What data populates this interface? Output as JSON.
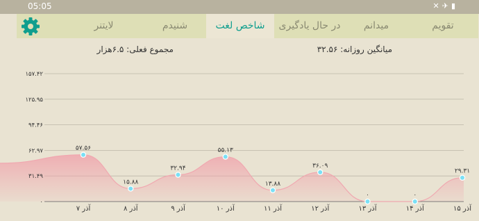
{
  "status_bar": {
    "time": "05:05",
    "icons": [
      "mute-icon",
      "airplane-icon",
      "battery-icon"
    ]
  },
  "tabs": [
    {
      "label": "تقویم",
      "active": false
    },
    {
      "label": "میدانم",
      "active": false
    },
    {
      "label": "در حال یادگیری",
      "active": false
    },
    {
      "label": "شاخص لغت",
      "active": true
    },
    {
      "label": "شنیدم",
      "active": false
    },
    {
      "label": "لایتنر",
      "active": false
    }
  ],
  "settings_icon": "gear-icon",
  "summary": {
    "daily_average": "میانگین روزانه: ۳۲.۵۶",
    "actual_total": "مجموع فعلی: ۶.۵هزار"
  },
  "colors": {
    "accent": "#0f9e8e",
    "tab_bar": "#dedfb6",
    "background": "#e9e3d2",
    "line": "#f0a8b0",
    "point": "#7ae0f5"
  },
  "chart_data": {
    "type": "area",
    "ylim": [
      0,
      157.42
    ],
    "y_ticks": [
      "157.42",
      "125.95",
      "94.46",
      "62.97",
      "31.49",
      "0"
    ],
    "y_tick_labels": [
      "۱۵۷.۴۲",
      "۱۲۵.۹۵",
      "۹۴.۴۶",
      "۶۲.۹۷",
      "۳۱.۴۹",
      "۰"
    ],
    "x_labels": [
      "۷ آذر",
      "۸ آذر",
      "۹ آذر",
      "۱۰ آذر",
      "۱۱ آذر",
      "۱۲ آذر",
      "۱۳ آذر",
      "۱۴ آذر",
      "۱۵ آذر"
    ],
    "values": [
      57.56,
      15.88,
      32.94,
      55.13,
      13.88,
      36.09,
      0,
      0,
      29.31
    ],
    "value_labels": [
      "۵۷.۵۶",
      "۱۵.۸۸",
      "۳۲.۹۴",
      "۵۵.۱۳",
      "۱۳.۸۸",
      "۳۶.۰۹",
      "۰",
      "۰",
      "۲۹.۳۱"
    ],
    "grid": true
  }
}
